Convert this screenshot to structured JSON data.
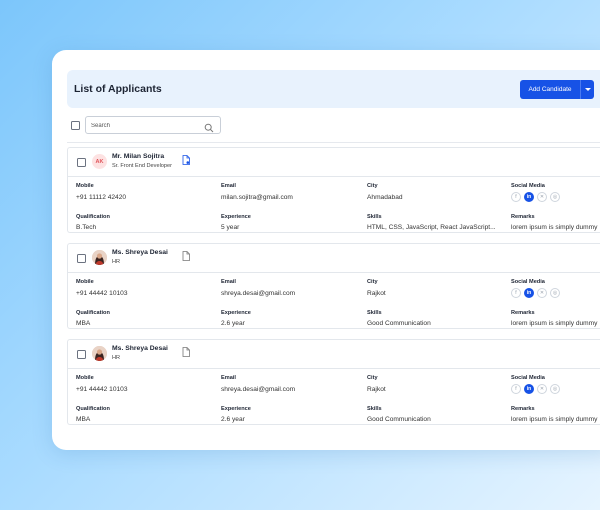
{
  "page": {
    "title": "List of Applicants",
    "add_button": "Add Candidate"
  },
  "search": {
    "placeholder": "Search"
  },
  "fields": {
    "mobile": "Mobile",
    "email": "Email",
    "city": "City",
    "social": "Social Media",
    "qualification": "Qualification",
    "experience": "Experience",
    "skills": "Skills",
    "remarks": "Remarks"
  },
  "social_icons": [
    "facebook-icon",
    "linkedin-icon",
    "x-icon",
    "github-icon"
  ],
  "social_glyphs": {
    "facebook": "f",
    "linkedin": "in",
    "x": "✕",
    "github": "◎"
  },
  "applicants": [
    {
      "initials": "AK",
      "name": "Mr. Milan Sojitra",
      "role": "Sr. Front End Developer",
      "mobile": "+91 11112 42420",
      "email": "milan.sojitra@gmail.com",
      "city": "Ahmadabad",
      "qualification": "B.Tech",
      "experience": "5 year",
      "skills": "HTML, CSS, JavaScript, React JavaScript...",
      "remarks": "lorem ipsum is simply dummy"
    },
    {
      "name": "Ms. Shreya Desai",
      "role": "HR",
      "mobile": "+91 44442 10103",
      "email": "shreya.desai@gmail.com",
      "city": "Rajkot",
      "qualification": "MBA",
      "experience": "2.6 year",
      "skills": "Good Communication",
      "remarks": "lorem ipsum is simply dummy"
    },
    {
      "name": "Ms. Shreya Desai",
      "role": "HR",
      "mobile": "+91 44442 10103",
      "email": "shreya.desai@gmail.com",
      "city": "Rajkot",
      "qualification": "MBA",
      "experience": "2.6 year",
      "skills": "Good Communication",
      "remarks": "lorem ipsum is simply dummy"
    }
  ],
  "colors": {
    "accent": "#1752e6",
    "header_bg": "#e8f2fd",
    "initials_bg": "#fde2e2",
    "initials_fg": "#e0545a"
  }
}
